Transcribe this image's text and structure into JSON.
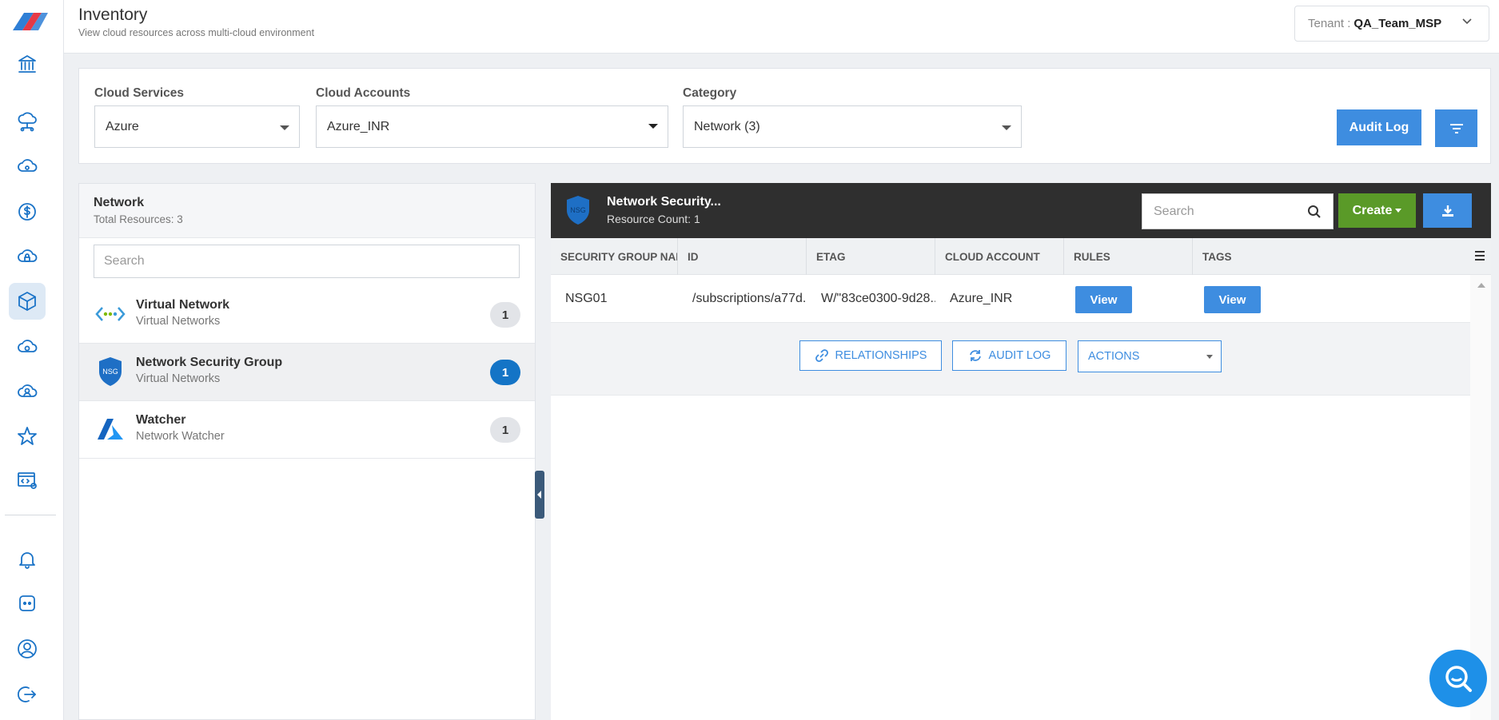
{
  "header": {
    "title": "Inventory",
    "subtitle": "View cloud resources across multi-cloud environment",
    "tenant_label": "Tenant :",
    "tenant_value": "QA_Team_MSP"
  },
  "sidebar": {
    "icons": [
      "bank-icon",
      "cloud-network-icon",
      "cloud-icon",
      "dollar-icon",
      "cloud-lock-icon",
      "cube-icon",
      "cloud-gear-icon",
      "cloud-user-icon",
      "star-icon",
      "code-settings-icon",
      "bell-icon",
      "chat-bot-icon",
      "user-circle-icon",
      "logout-icon"
    ],
    "active": "cube-icon"
  },
  "filters": {
    "cloud_services": {
      "label": "Cloud Services",
      "value": "Azure"
    },
    "cloud_accounts": {
      "label": "Cloud Accounts",
      "value": "Azure_INR"
    },
    "category": {
      "label": "Category",
      "value": "Network (3)"
    },
    "audit_log_button": "Audit Log"
  },
  "list_panel": {
    "title": "Network",
    "subtitle": "Total Resources: 3",
    "search_placeholder": "Search",
    "items": [
      {
        "name": "Virtual Network",
        "type": "Virtual Networks",
        "count": "1"
      },
      {
        "name": "Network Security Group",
        "type": "Virtual Networks",
        "count": "1"
      },
      {
        "name": "Watcher",
        "type": "Network Watcher",
        "count": "1"
      }
    ]
  },
  "detail": {
    "title": "Network Security...",
    "subtitle": "Resource Count: 1",
    "icon_text": "NSG",
    "search_placeholder": "Search",
    "create_label": "Create",
    "columns": [
      "Security Group Nam...",
      "ID",
      "ETAG",
      "Cloud Account",
      "Rules",
      "Tags"
    ],
    "rows": [
      {
        "name": "NSG01",
        "id": "/subscriptions/a77d...",
        "etag": "W/\"83ce0300-9d28...",
        "account": "Azure_INR",
        "rules": "View",
        "tags": "View"
      }
    ],
    "actions": {
      "relationships": "RELATIONSHIPS",
      "audit_log": "AUDIT LOG",
      "actions": "ACTIONS"
    }
  },
  "colors": {
    "accent": "#3e8de0",
    "create_green": "#5a9a28",
    "header_dark": "#2f2f2f",
    "rail_icon": "#1a73c7"
  }
}
